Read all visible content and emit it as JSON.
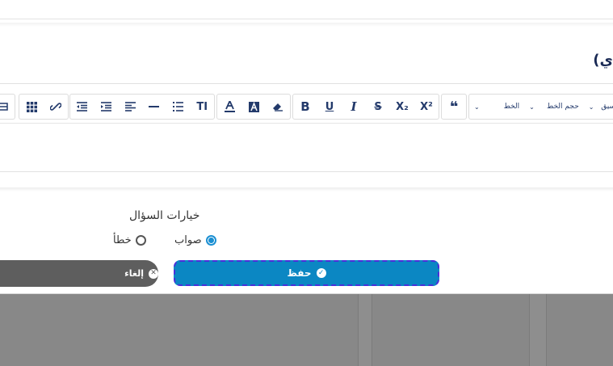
{
  "dialog": {
    "title": "ي)"
  },
  "toolbar": {
    "quote_icon": "quote-icon",
    "font_label": "الخط",
    "font_size_label": "حجم الخط",
    "format_label": "نسيق",
    "buttons": [
      "B",
      "U",
      "I",
      "S",
      "X₂",
      "X²"
    ],
    "text_size_glyph": "TI"
  },
  "question_options": {
    "heading": "خيارات السؤال",
    "correct_label": "صواب",
    "wrong_label": "خطأ",
    "selected": "correct"
  },
  "actions": {
    "save_label": "حفظ",
    "cancel_label": "إلغاء"
  },
  "colors": {
    "primary": "#0b87c3",
    "cancel": "#5e5e5e",
    "title": "#1a2a55",
    "icon": "#233a6b",
    "focus_outline": "#4b2fd9"
  }
}
